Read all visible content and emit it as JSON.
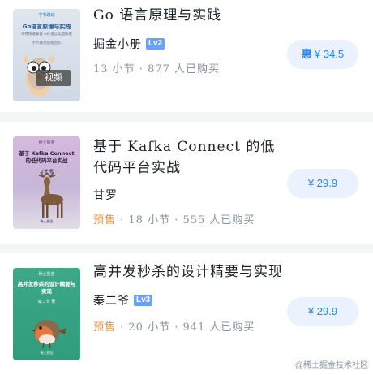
{
  "books": [
    {
      "title": "Go 语言原理与实践",
      "author": "掘金小册",
      "level": "Lv2",
      "meta_prefix": "",
      "meta": "13 小节 · 877 人已购买",
      "price_prefix": "惠",
      "price": "¥ 34.5",
      "badge": "视频",
      "cover": {
        "brand": "字节跳动",
        "title": "Go语言原理与实践",
        "subtitle": "带你快速掌握 Go 语言实战技能",
        "author": "字节跳动后端团队",
        "publisher": ""
      }
    },
    {
      "title": "基于 Kafka Connect 的低代码平台实战",
      "author": "甘罗",
      "level": "",
      "meta_prefix": "预售",
      "meta": " · 18 小节 · 555 人已购买",
      "price_prefix": "",
      "price": "¥ 29.9",
      "badge": "",
      "cover": {
        "brand": "稀土掘金",
        "title": "基于 Kafka Connect 的低代码平台实战",
        "subtitle": "",
        "author": "甘罗 著",
        "publisher": "稀土掘金"
      }
    },
    {
      "title": "高并发秒杀的设计精要与实现",
      "author": "秦二爷",
      "level": "Lv3",
      "meta_prefix": "预售",
      "meta": " · 20 小节 · 941 人已购买",
      "price_prefix": "",
      "price": "¥ 29.9",
      "badge": "",
      "cover": {
        "brand": "稀土掘金",
        "title": "高并发秒杀的设计精要与实现",
        "subtitle": "",
        "author": "秦二爷 著",
        "publisher": "稀土掘金"
      }
    }
  ],
  "watermark": "@稀土掘金技术社区",
  "colors": {
    "accent": "#1e80ff",
    "price_bg": "#eaf2ff",
    "presale": "#e5933b",
    "level_badge": "#6aa1ff",
    "meta_text": "#8a919f"
  }
}
